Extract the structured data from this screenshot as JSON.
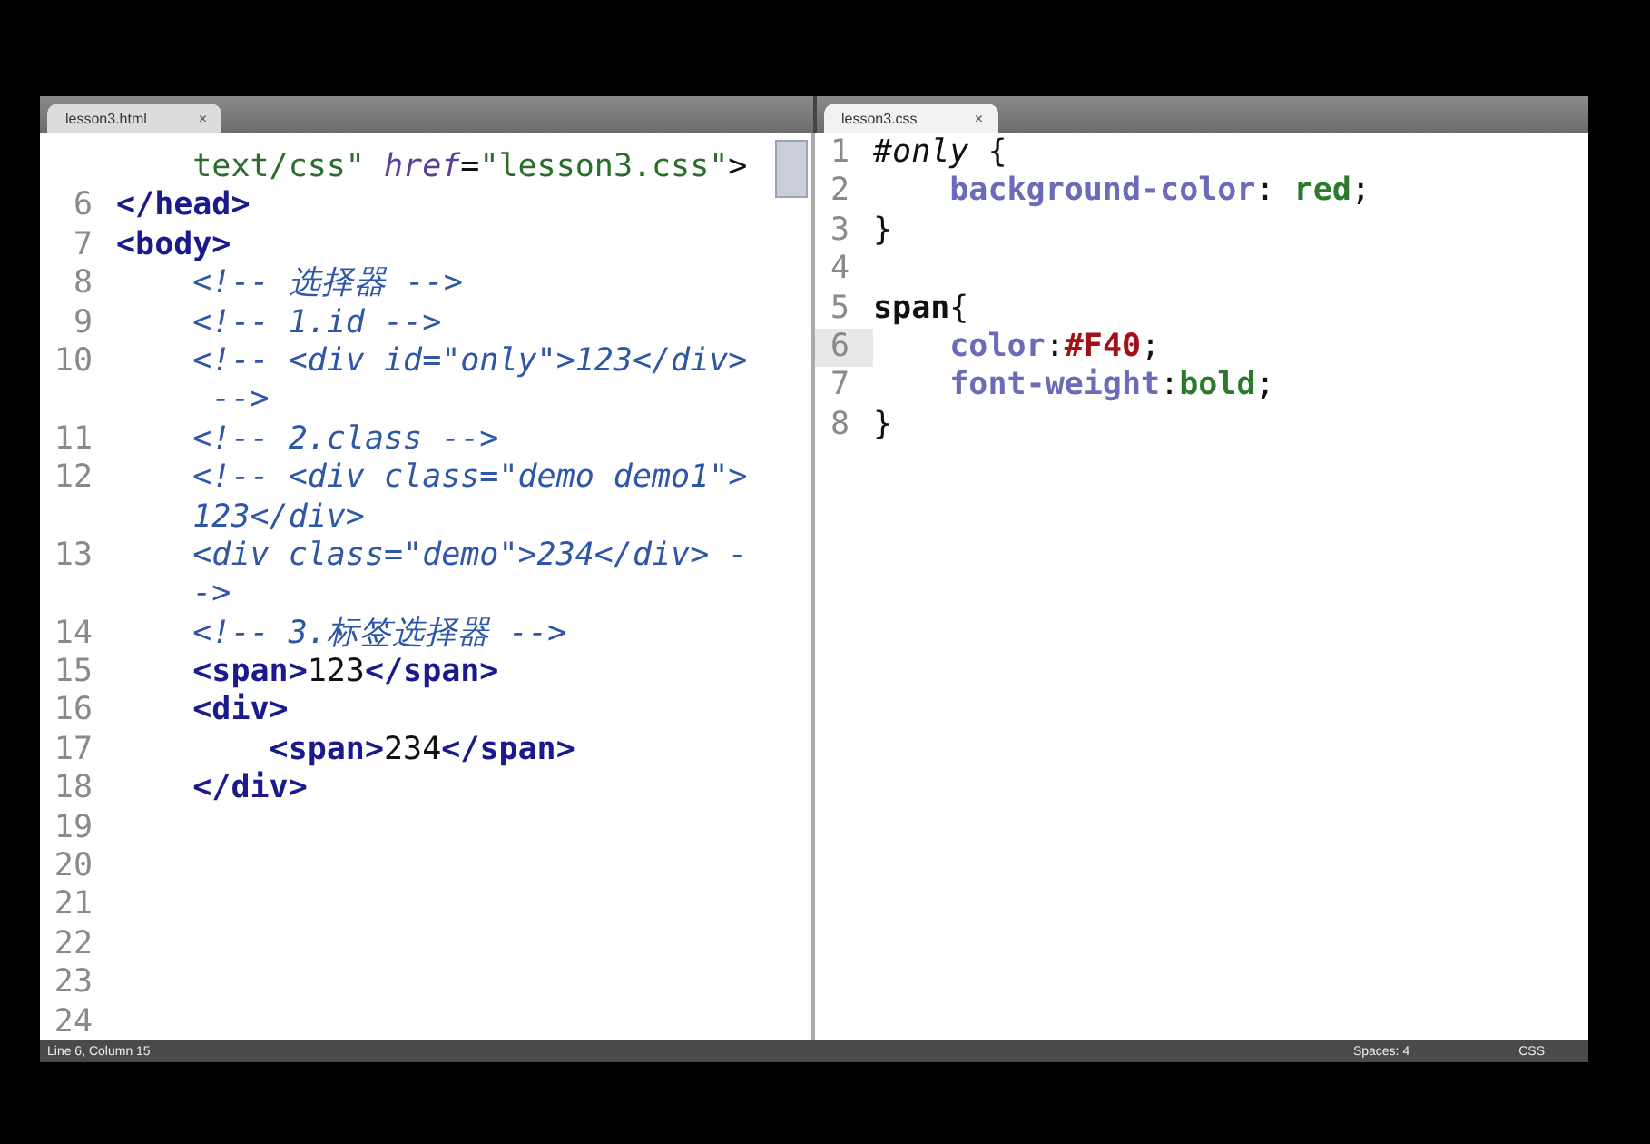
{
  "panes": [
    {
      "tab": {
        "title": "lesson3.html",
        "close": "×",
        "selected": false
      },
      "kind": "markup",
      "lines": [
        {
          "tokens": [
            {
              "text": "    text/css\"",
              "kind": "str"
            },
            {
              "text": " href",
              "kind": "attr"
            },
            {
              "text": "=",
              "kind": "plain"
            },
            {
              "text": "\"lesson3.css\"",
              "kind": "str"
            },
            {
              "text": ">",
              "kind": "plain"
            }
          ]
        },
        {
          "number": "6",
          "tokens": [
            {
              "text": "</head>",
              "kind": "tag"
            }
          ]
        },
        {
          "number": "7",
          "tokens": [
            {
              "text": "<body>",
              "kind": "tag"
            }
          ]
        },
        {
          "number": "8",
          "tokens": [
            {
              "text": "    <!-- 选择器 -->",
              "kind": "comment"
            }
          ]
        },
        {
          "number": "9",
          "tokens": [
            {
              "text": "    <!-- 1.id -->",
              "kind": "comment"
            }
          ]
        },
        {
          "number": "10",
          "tokens": [
            {
              "text": "    <!-- <div id=\"only\">123</div>",
              "kind": "comment"
            }
          ]
        },
        {
          "tokens": [
            {
              "text": "     -->",
              "kind": "comment"
            }
          ]
        },
        {
          "number": "11",
          "tokens": [
            {
              "text": "    <!-- 2.class -->",
              "kind": "comment"
            }
          ]
        },
        {
          "number": "12",
          "tokens": [
            {
              "text": "    <!-- <div class=\"demo demo1\">",
              "kind": "comment"
            }
          ]
        },
        {
          "tokens": [
            {
              "text": "    123</div>",
              "kind": "comment"
            }
          ]
        },
        {
          "number": "13",
          "tokens": [
            {
              "text": "    <div class=\"demo\">234</div> -",
              "kind": "comment"
            }
          ]
        },
        {
          "tokens": [
            {
              "text": "    ->",
              "kind": "comment"
            }
          ]
        },
        {
          "number": "14",
          "tokens": [
            {
              "text": "    <!-- 3.标签选择器 -->",
              "kind": "comment"
            }
          ]
        },
        {
          "number": "15",
          "tokens": [
            {
              "text": "    <span>",
              "kind": "tag"
            },
            {
              "text": "123",
              "kind": "plain"
            },
            {
              "text": "</span>",
              "kind": "tag"
            }
          ]
        },
        {
          "number": "16",
          "tokens": [
            {
              "text": "    <div>",
              "kind": "tag"
            }
          ]
        },
        {
          "number": "17",
          "tokens": [
            {
              "text": "        <span>",
              "kind": "tag"
            },
            {
              "text": "234",
              "kind": "plain"
            },
            {
              "text": "</span>",
              "kind": "tag"
            }
          ]
        },
        {
          "number": "18",
          "tokens": [
            {
              "text": "    </div>",
              "kind": "tag"
            }
          ]
        },
        {
          "number": "19"
        },
        {
          "number": "20"
        },
        {
          "number": "21"
        },
        {
          "number": "22"
        },
        {
          "number": "23"
        },
        {
          "number": "24"
        }
      ]
    },
    {
      "tab": {
        "title": "lesson3.css",
        "close": "×",
        "selected": true
      },
      "kind": "stylesheet",
      "lines": [
        {
          "number": "1",
          "current": false,
          "tokens": [
            {
              "text": "#only",
              "kind": "selector-id"
            },
            {
              "text": " {",
              "kind": "plain"
            }
          ]
        },
        {
          "number": "2",
          "current": false,
          "tokens": [
            {
              "text": "    background-color",
              "kind": "prop"
            },
            {
              "text": ": ",
              "kind": "plain"
            },
            {
              "text": "red",
              "kind": "value"
            },
            {
              "text": ";",
              "kind": "plain"
            }
          ]
        },
        {
          "number": "3",
          "current": false,
          "tokens": [
            {
              "text": "}",
              "kind": "plain"
            }
          ]
        },
        {
          "number": "4",
          "current": false
        },
        {
          "number": "5",
          "current": false,
          "tokens": [
            {
              "text": "span",
              "kind": "selector"
            },
            {
              "text": "{",
              "kind": "plain"
            }
          ]
        },
        {
          "number": "6",
          "current": true,
          "tokens": [
            {
              "text": "    color",
              "kind": "prop"
            },
            {
              "text": ":",
              "kind": "plain"
            },
            {
              "text": "#F40",
              "kind": "color-value"
            },
            {
              "text": ";",
              "kind": "plain"
            }
          ]
        },
        {
          "number": "7",
          "current": false,
          "tokens": [
            {
              "text": "    font-weight",
              "kind": "prop"
            },
            {
              "text": ":",
              "kind": "plain"
            },
            {
              "text": "bold",
              "kind": "value"
            },
            {
              "text": ";",
              "kind": "plain"
            }
          ]
        },
        {
          "number": "8",
          "current": false,
          "tokens": [
            {
              "text": "}",
              "kind": "plain"
            }
          ]
        }
      ]
    }
  ],
  "status_bar": {
    "position": "Line 6, Column 15",
    "indentation": "Spaces: 4",
    "syntax": "CSS"
  }
}
